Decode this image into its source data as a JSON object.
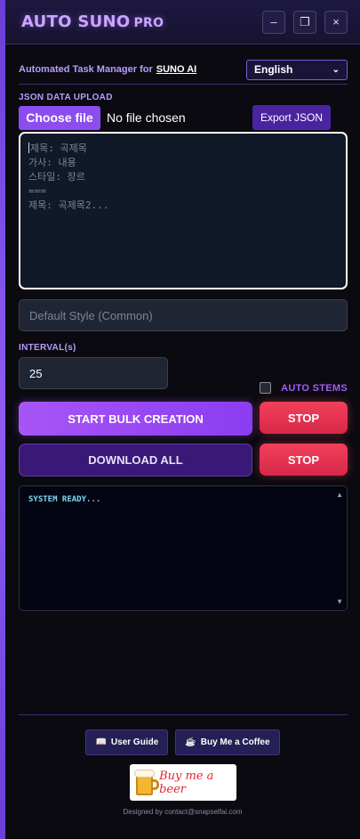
{
  "header": {
    "title": "AUTO SUNO",
    "title_suffix": "PRO",
    "minimize": "–",
    "maximize": "❐",
    "close": "×"
  },
  "subtitle": {
    "text": "Automated Task Manager for",
    "brand": "SUNO AI"
  },
  "language": {
    "selected": "English",
    "chevron": "⌄"
  },
  "upload": {
    "label": "JSON DATA UPLOAD",
    "choose_button": "Choose file",
    "file_status": "No file chosen",
    "export_button": "Export JSON",
    "placeholder": "제목: 곡제목\n가사: 내용\n스타일: 장르\n===\n제목: 곡제목2..."
  },
  "style_field": {
    "placeholder": "Default Style (Common)"
  },
  "interval": {
    "label": "INTERVAL(s)",
    "value": "25"
  },
  "auto_stems": {
    "label": "AUTO STEMS",
    "checked": false
  },
  "actions": {
    "start": "START BULK CREATION",
    "stop_1": "STOP",
    "download": "DOWNLOAD ALL",
    "stop_2": "STOP"
  },
  "log": {
    "text": "SYSTEM READY..."
  },
  "footer": {
    "guide_icon": "📖",
    "guide": "User Guide",
    "coffee_icon": "☕",
    "coffee": "Buy Me a Coffee",
    "beer": "Buy me a beer",
    "credit": "Designed by contact@snapselfai.com"
  },
  "colors": {
    "accent": "#a855f7",
    "stop": "#e8354f",
    "background": "#0b0a10"
  }
}
